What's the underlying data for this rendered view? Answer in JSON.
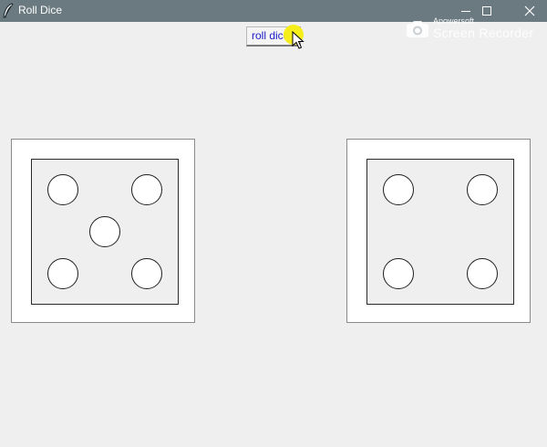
{
  "window": {
    "title": "Roll Dice",
    "app_icon": "feather-icon",
    "controls": [
      {
        "name": "minimize",
        "icon": "minimize-icon"
      },
      {
        "name": "maximize",
        "icon": "maximize-icon"
      },
      {
        "name": "close",
        "icon": "close-icon"
      }
    ]
  },
  "watermark": {
    "brand": "Apowersoft",
    "product": "Screen Recorder"
  },
  "toolbar": {
    "roll_label": "roll dice",
    "cursor_icon": "arrow-cursor-icon",
    "cursor_highlight_color": "#f5ee1a"
  },
  "dice": [
    {
      "name": "left-die",
      "value": 5
    },
    {
      "name": "right-die",
      "value": 4
    }
  ],
  "colors": {
    "titlebar": "#6b7a80",
    "background": "#efefef",
    "button_text": "#1b1bc8"
  }
}
